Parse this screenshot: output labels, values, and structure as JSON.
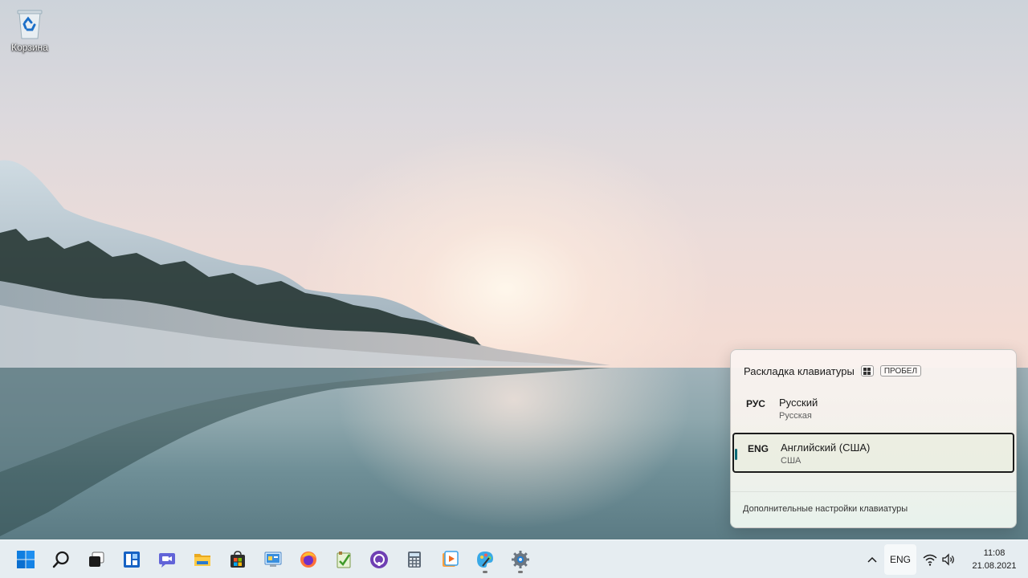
{
  "desktop": {
    "recycle_bin_label": "Корзина"
  },
  "flyout": {
    "title": "Раскладка клавиатуры",
    "shortcut_key": "ПРОБЕЛ",
    "languages": [
      {
        "code": "РУС",
        "name": "Русский",
        "sub": "Русская",
        "selected": false
      },
      {
        "code": "ENG",
        "name": "Английский (США)",
        "sub": "США",
        "selected": true
      }
    ],
    "more_settings": "Дополнительные настройки клавиатуры"
  },
  "taskbar": {
    "apps": [
      {
        "name": "start-button",
        "icon": "windows-logo-icon",
        "running": false
      },
      {
        "name": "search-button",
        "icon": "search-icon",
        "running": false
      },
      {
        "name": "task-view-button",
        "icon": "task-view-icon",
        "running": false
      },
      {
        "name": "widgets-button",
        "icon": "widgets-icon",
        "running": false
      },
      {
        "name": "teams-chat-button",
        "icon": "teams-chat-icon",
        "running": false
      },
      {
        "name": "file-explorer-button",
        "icon": "folder-icon",
        "running": false
      },
      {
        "name": "microsoft-store-button",
        "icon": "store-icon",
        "running": false
      },
      {
        "name": "control-panel-button",
        "icon": "control-panel-icon",
        "running": false
      },
      {
        "name": "firefox-button",
        "icon": "firefox-icon",
        "running": false
      },
      {
        "name": "notepad-button",
        "icon": "notepad-icon",
        "running": false
      },
      {
        "name": "github-button",
        "icon": "github-icon",
        "running": false
      },
      {
        "name": "calculator-button",
        "icon": "calculator-icon",
        "running": false
      },
      {
        "name": "media-player-button",
        "icon": "media-player-icon",
        "running": false
      },
      {
        "name": "paint-button",
        "icon": "paint-icon",
        "running": true
      },
      {
        "name": "settings-button",
        "icon": "gear-icon",
        "running": true
      }
    ],
    "tray": {
      "language": "ENG",
      "time": "11:08",
      "date": "21.08.2021"
    }
  },
  "colors": {
    "accent": "#0b6a77",
    "taskbar_bg": "#e5ecf0"
  }
}
